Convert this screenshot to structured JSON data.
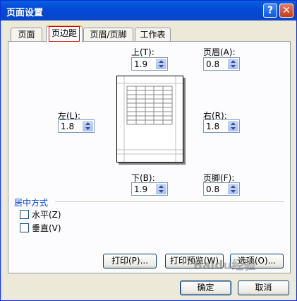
{
  "window": {
    "title": "页面设置"
  },
  "tabs": [
    {
      "label": "页面",
      "active": false
    },
    {
      "label": "页边距",
      "active": true
    },
    {
      "label": "页眉/页脚",
      "active": false
    },
    {
      "label": "工作表",
      "active": false
    }
  ],
  "margins": {
    "top": {
      "label": "上(T):",
      "value": "1.9"
    },
    "header": {
      "label": "页眉(A):",
      "value": "0.8"
    },
    "left": {
      "label": "左(L):",
      "value": "1.8"
    },
    "right": {
      "label": "右(R):",
      "value": "1.8"
    },
    "bottom": {
      "label": "下(B):",
      "value": "1.9"
    },
    "footer": {
      "label": "页脚(F):",
      "value": "0.8"
    }
  },
  "center": {
    "title": "居中方式",
    "horizontal": {
      "label": "水平(Z)",
      "checked": false
    },
    "vertical": {
      "label": "垂直(V)",
      "checked": false
    }
  },
  "buttons": {
    "print": "打印(P)...",
    "print_preview": "打印预览(W)",
    "options": "选项(O)...",
    "ok": "确定",
    "cancel": "取消"
  },
  "watermark": "Baidu经验",
  "icons": {
    "help": "question-icon",
    "close": "close-icon"
  }
}
